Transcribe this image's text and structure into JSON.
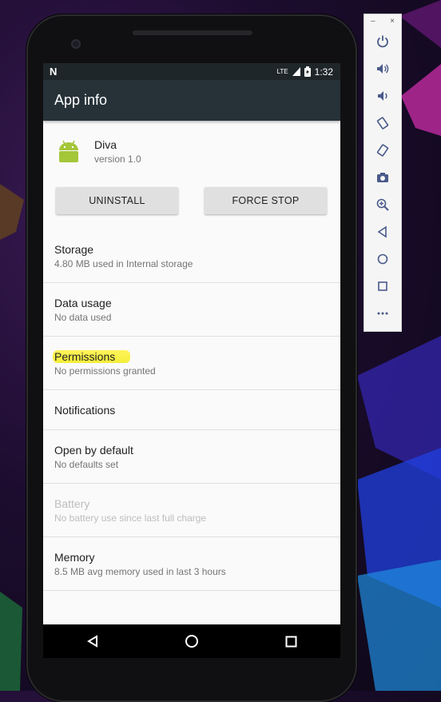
{
  "status_bar": {
    "time": "1:32",
    "network_label": "LTE"
  },
  "app_bar": {
    "title": "App info"
  },
  "app": {
    "name": "Diva",
    "version": "version 1.0"
  },
  "buttons": {
    "uninstall": "UNINSTALL",
    "force_stop": "FORCE STOP"
  },
  "items": [
    {
      "title": "Storage",
      "subtitle": "4.80 MB used in Internal storage"
    },
    {
      "title": "Data usage",
      "subtitle": "No data used"
    },
    {
      "title": "Permissions",
      "subtitle": "No permissions granted"
    },
    {
      "title": "Notifications"
    },
    {
      "title": "Open by default",
      "subtitle": "No defaults set"
    },
    {
      "title": "Battery",
      "subtitle": "No battery use since last full charge"
    },
    {
      "title": "Memory",
      "subtitle": "8.5 MB avg memory used in last 3 hours"
    }
  ],
  "emulator_toolbar": {
    "minimize": "–",
    "close": "×",
    "icons": [
      "power-icon",
      "volume-up-icon",
      "volume-down-icon",
      "rotate-left-icon",
      "rotate-right-icon",
      "camera-icon",
      "zoom-icon",
      "back-icon",
      "home-icon",
      "overview-icon",
      "more-icon"
    ]
  },
  "colors": {
    "app_bar": "#263238",
    "status_bar": "#1f262a",
    "highlight": "#f7f042",
    "android_green": "#a4c639"
  }
}
